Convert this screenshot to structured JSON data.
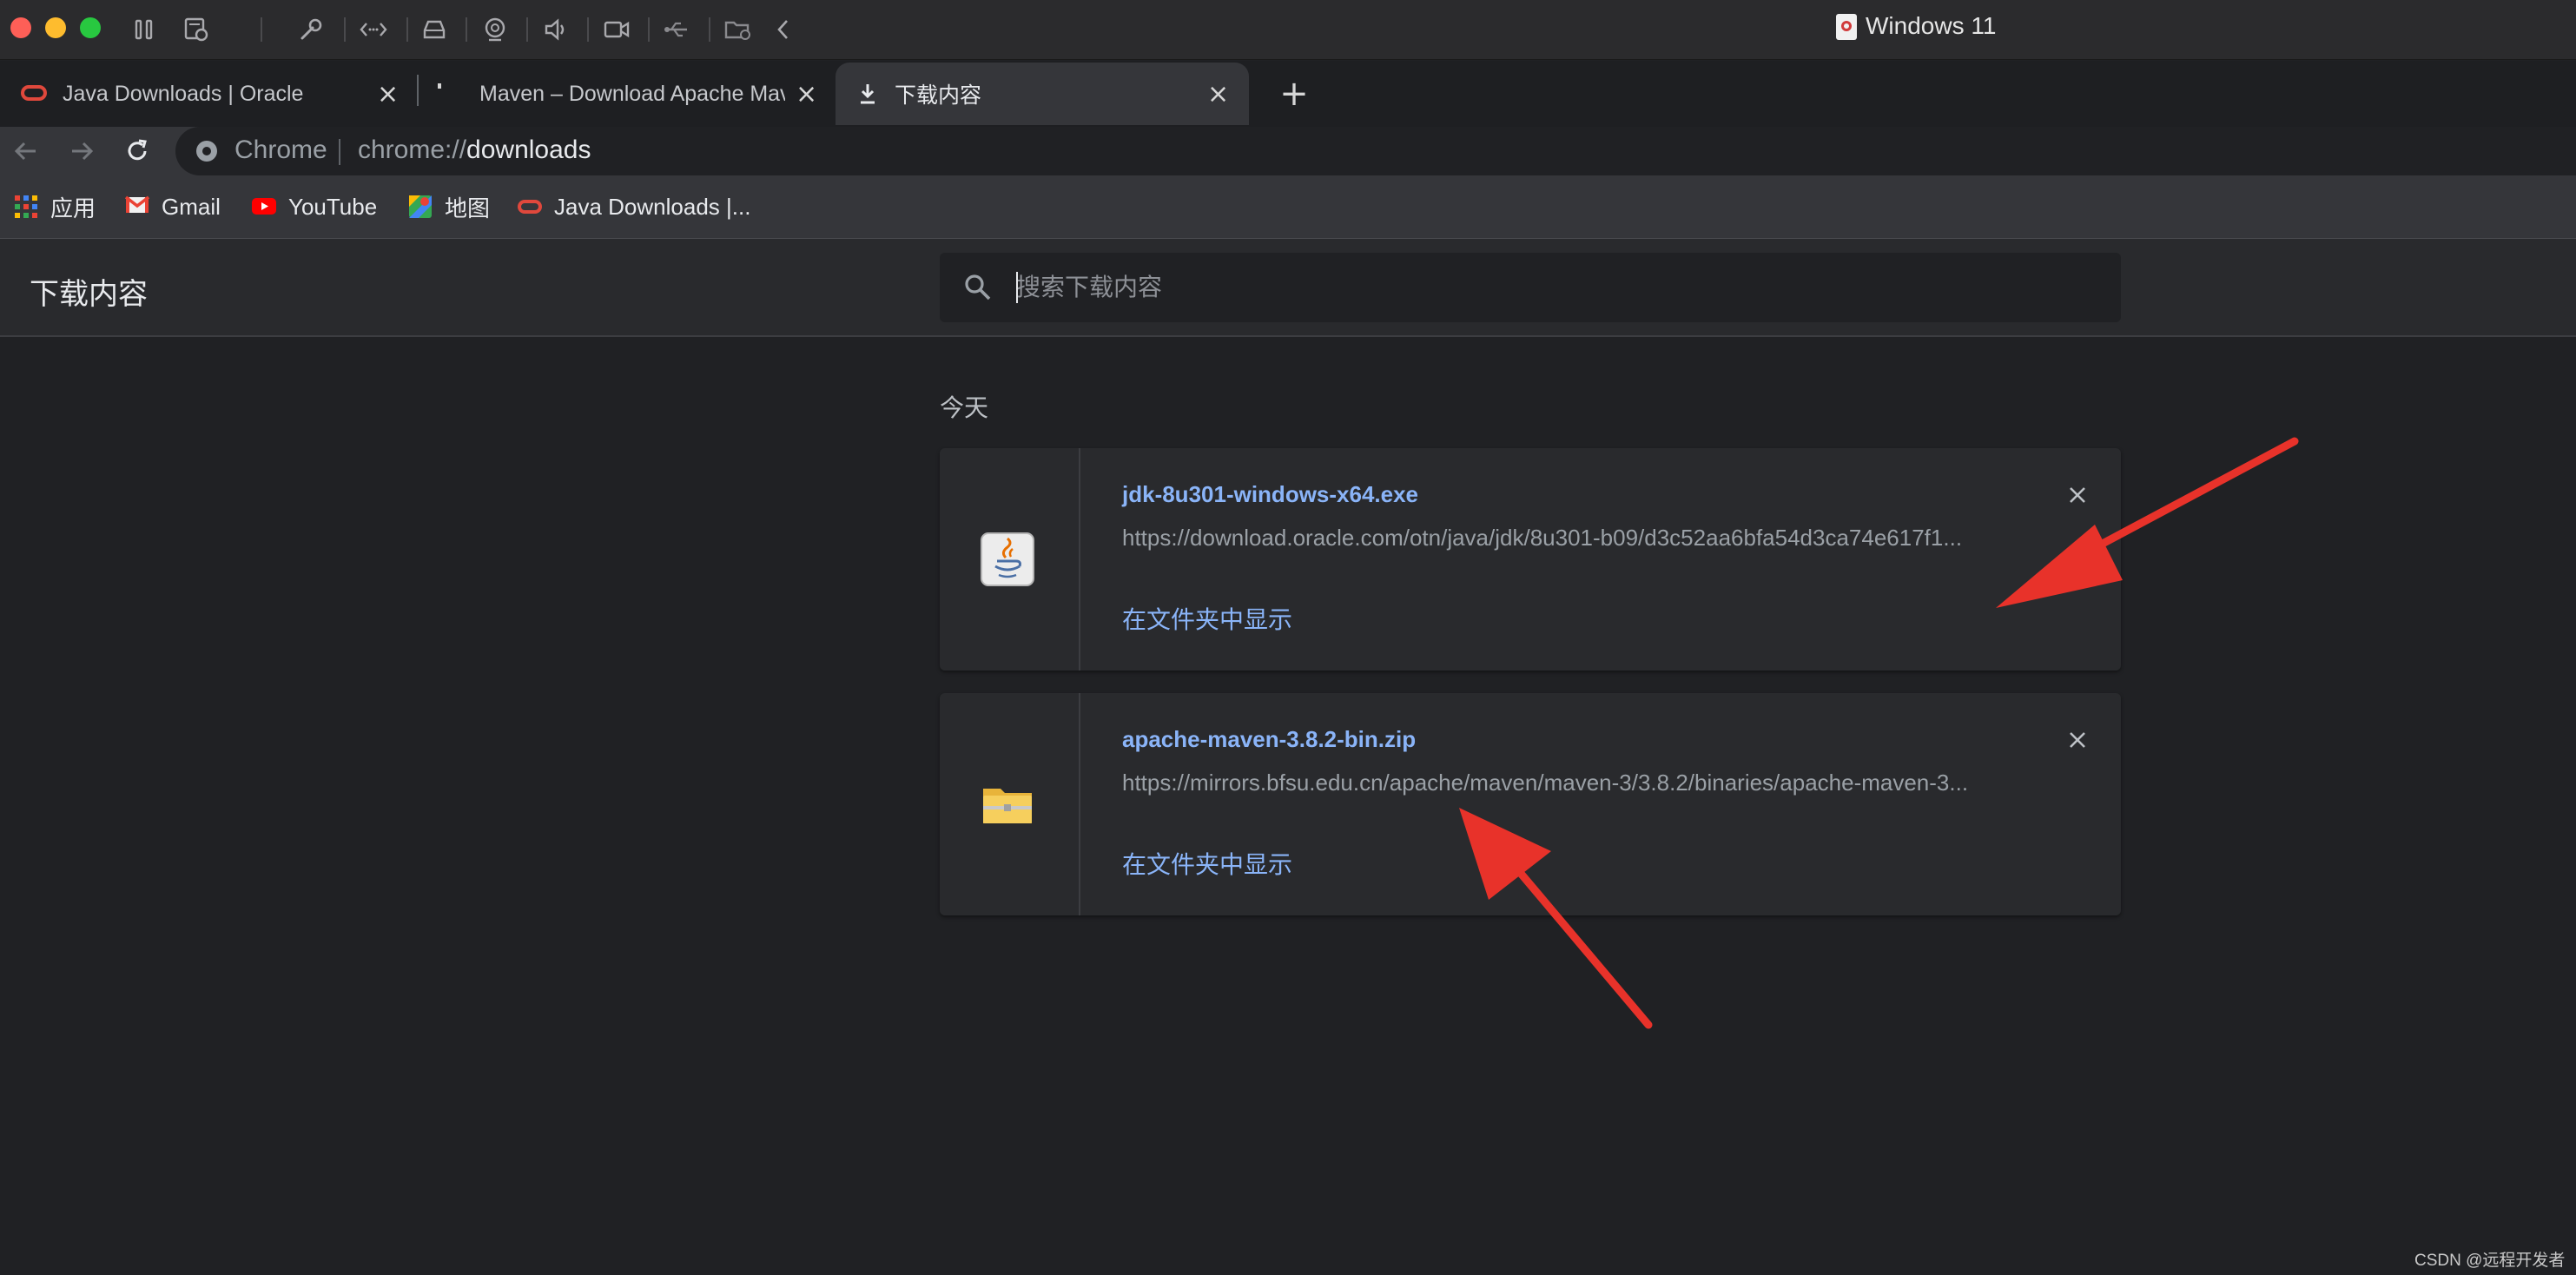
{
  "vm": {
    "title": "Windows 11",
    "icons": [
      "pause-icon",
      "snapshot-icon",
      "wrench-icon",
      "code-icon",
      "drive-icon",
      "webcam-icon",
      "speaker-icon",
      "camera-icon",
      "usb-icon",
      "shared-folder-icon",
      "chevron-left-icon"
    ]
  },
  "tabs": [
    {
      "label": "Java Downloads | Oracle",
      "icon": "oracle-icon",
      "active": false
    },
    {
      "label": "Maven – Download Apache Maven",
      "icon": "maven-icon",
      "active": false
    },
    {
      "label": "下载内容",
      "icon": "download-icon",
      "active": true
    }
  ],
  "omnibox": {
    "chip": "Chrome",
    "scheme": "chrome://",
    "host": "downloads"
  },
  "bookmarks": [
    {
      "label": "应用",
      "icon": "apps-grid-icon"
    },
    {
      "label": "Gmail",
      "icon": "gmail-icon"
    },
    {
      "label": "YouTube",
      "icon": "youtube-icon"
    },
    {
      "label": "地图",
      "icon": "maps-icon"
    },
    {
      "label": "Java Downloads |...",
      "icon": "oracle-icon"
    }
  ],
  "downloads_page": {
    "title": "下载内容",
    "search_placeholder": "搜索下载内容",
    "date_heading": "今天",
    "items": [
      {
        "file_name": "jdk-8u301-windows-x64.exe",
        "url": "https://download.oracle.com/otn/java/jdk/8u301-b09/d3c52aa6bfa54d3ca74e617f1...",
        "action": "在文件夹中显示",
        "icon": "java-installer-icon"
      },
      {
        "file_name": "apache-maven-3.8.2-bin.zip",
        "url": "https://mirrors.bfsu.edu.cn/apache/maven/maven-3/3.8.2/binaries/apache-maven-3...",
        "action": "在文件夹中显示",
        "icon": "zip-folder-icon"
      }
    ]
  },
  "watermark": "CSDN @远程开发者",
  "colors": {
    "accent_link": "#8ab4f8",
    "page_bg": "#202124",
    "annotation_arrow": "#e8322a"
  }
}
